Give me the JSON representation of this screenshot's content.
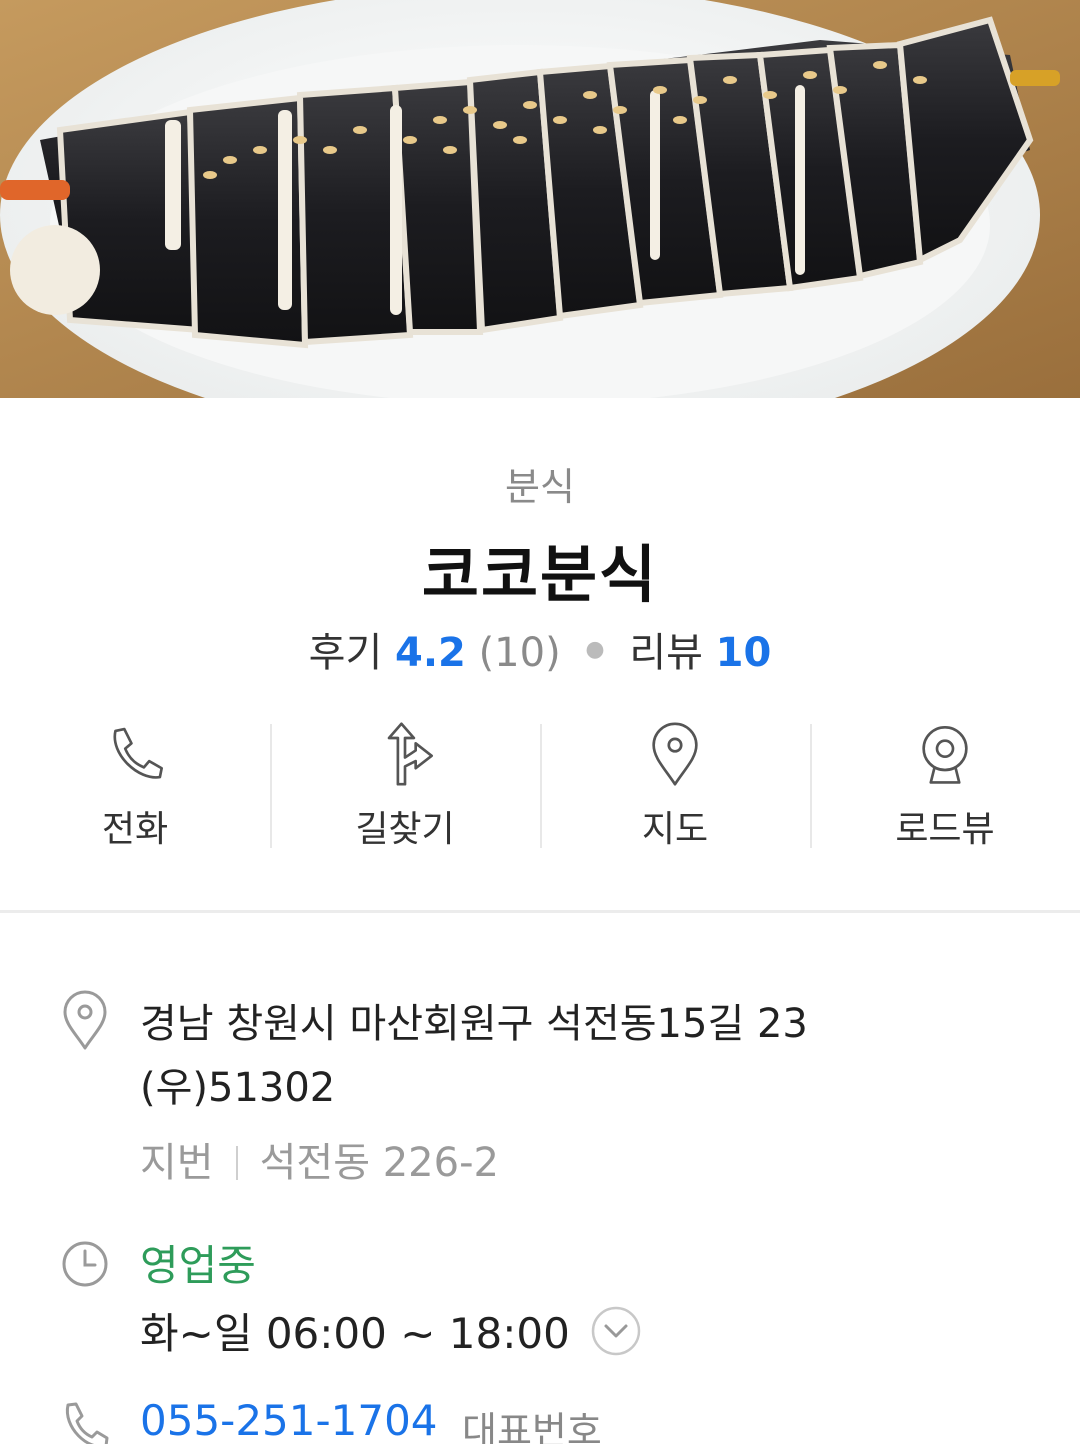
{
  "place": {
    "category": "분식",
    "name": "코코분식",
    "review_label": "후기",
    "review_score": "4.2",
    "review_count": "(10)",
    "blog_label": "리뷰",
    "blog_count": "10"
  },
  "actions": [
    {
      "label": "전화",
      "icon": "phone-icon"
    },
    {
      "label": "길찾기",
      "icon": "directions-icon"
    },
    {
      "label": "지도",
      "icon": "map-pin-icon"
    },
    {
      "label": "로드뷰",
      "icon": "roadview-icon"
    }
  ],
  "info": {
    "address_line1": "경남 창원시 마산회원구 석전동15길 23",
    "address_line2": "(우)51302",
    "jibun_label": "지번",
    "jibun_value": "석전동 226-2",
    "status": "영업중",
    "hours": "화~일 06:00 ~ 18:00",
    "phone": "055-251-1704",
    "phone_tag": "대표번호"
  },
  "colors": {
    "accent_blue": "#1a73e8",
    "open_green": "#2e9c5a"
  }
}
